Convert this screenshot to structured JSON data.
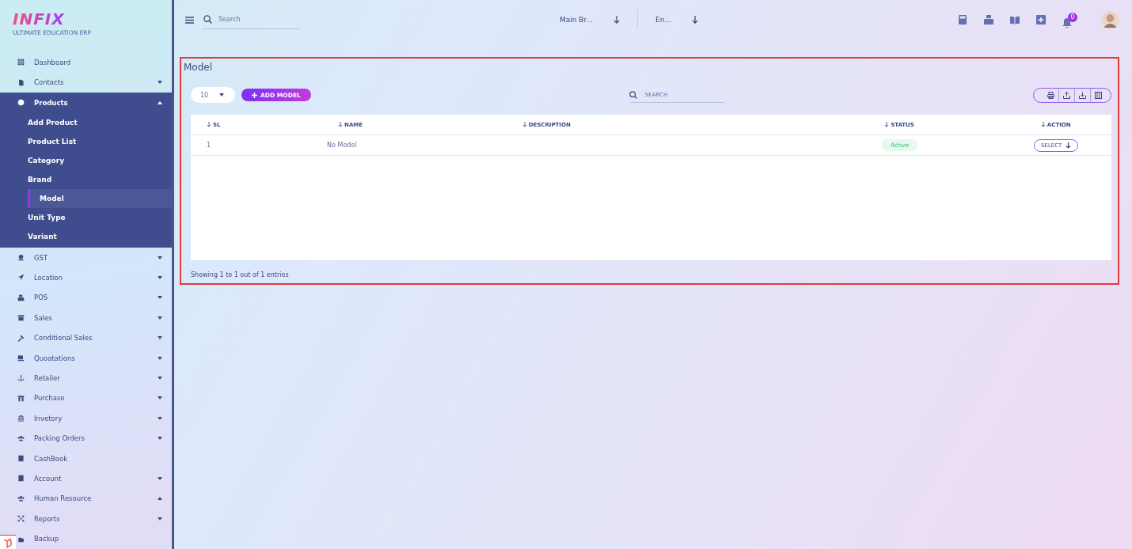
{
  "logo": {
    "name": "INFIX",
    "tagline": "ULTIMATE EDUCATION ERP"
  },
  "sidebar": {
    "items": [
      {
        "label": "Dashboard"
      },
      {
        "label": "Contacts",
        "expanded": false
      },
      {
        "label": "Products",
        "expanded": true,
        "children": [
          {
            "label": "Add Product",
            "selected": false
          },
          {
            "label": "Product List",
            "selected": false
          },
          {
            "label": "Category",
            "selected": false
          },
          {
            "label": "Brand",
            "selected": false
          },
          {
            "label": "Model",
            "selected": true
          },
          {
            "label": "Unit Type",
            "selected": false
          },
          {
            "label": "Variant",
            "selected": false
          }
        ]
      },
      {
        "label": "GST",
        "expanded": false
      },
      {
        "label": "Location",
        "expanded": false
      },
      {
        "label": "POS",
        "expanded": false
      },
      {
        "label": "Sales",
        "expanded": false
      },
      {
        "label": "Conditional Sales",
        "expanded": false
      },
      {
        "label": "Quoatations",
        "expanded": false
      },
      {
        "label": "Retailer",
        "expanded": false
      },
      {
        "label": "Purchase",
        "expanded": false
      },
      {
        "label": "Invetory",
        "expanded": false
      },
      {
        "label": "Packing Orders",
        "expanded": false
      },
      {
        "label": "CashBook"
      },
      {
        "label": "Account",
        "expanded": false
      },
      {
        "label": "Human Resource",
        "expanded": true
      },
      {
        "label": "Reports",
        "expanded": false
      },
      {
        "label": "Backup"
      }
    ]
  },
  "topbar": {
    "search": {
      "placeholder": "Search"
    },
    "branch": "Main Br...",
    "language": "En...",
    "notification_count": "0"
  },
  "panel": {
    "title": "Model",
    "page_size": "10",
    "add_button": "ADD MODEL",
    "search": {
      "placeholder": "SEARCH"
    },
    "table": {
      "columns": [
        "SL",
        "NAME",
        "DESCRIPTION",
        "STATUS",
        "ACTION"
      ],
      "rows": [
        {
          "sl": "1",
          "name": "No Model",
          "status": "Active",
          "action": "SELECT"
        }
      ]
    },
    "footer": "Showing 1 to 1 out of 1 entries"
  }
}
